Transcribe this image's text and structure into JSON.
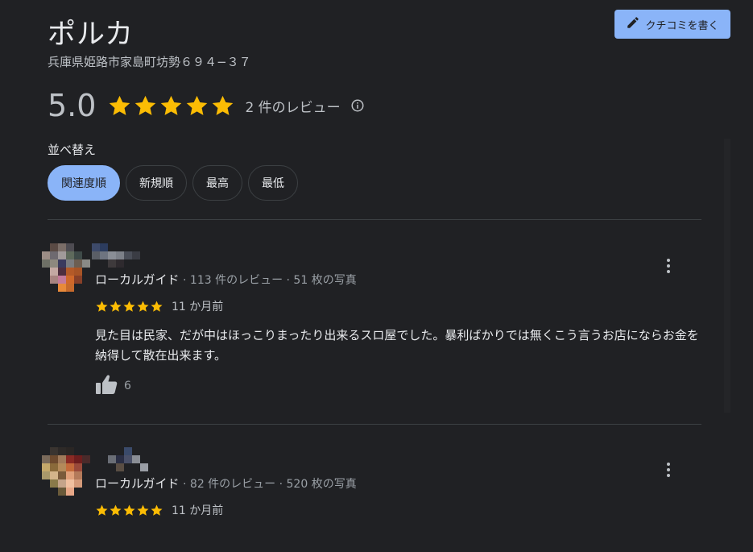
{
  "place": {
    "title": "ポルカ",
    "address": "兵庫県姫路市家島町坊勢６９４−３７"
  },
  "actions": {
    "write_review_label": "クチコミを書く",
    "write_review_icon": "pencil-icon"
  },
  "rating": {
    "score": "5.0",
    "stars": 5,
    "review_count": "2 件のレビュー",
    "info_icon": "info-icon"
  },
  "sort": {
    "label": "並べ替え",
    "options": [
      "関連度順",
      "新規順",
      "最高",
      "最低"
    ],
    "selected": "関連度順"
  },
  "reviews": [
    {
      "badge": "ローカルガイド",
      "stats": " · 113 件のレビュー · 51 枚の写真",
      "stars": 5,
      "time": "11 か月前",
      "text": "見た目は民家、だが中はほっこりまったり出来るスロ屋でした。暴利ばかりでは無くこう言うお店にならお金を納得して散在出来ます。",
      "likes": "6"
    },
    {
      "badge": "ローカルガイド",
      "stats": " · 82 件のレビュー · 520 枚の写真",
      "stars": 5,
      "time": "11 か月前"
    }
  ],
  "colors": {
    "background": "#202124",
    "accent": "#8ab4f8",
    "star": "#fbbc04",
    "text_secondary": "#bdc1c6"
  }
}
